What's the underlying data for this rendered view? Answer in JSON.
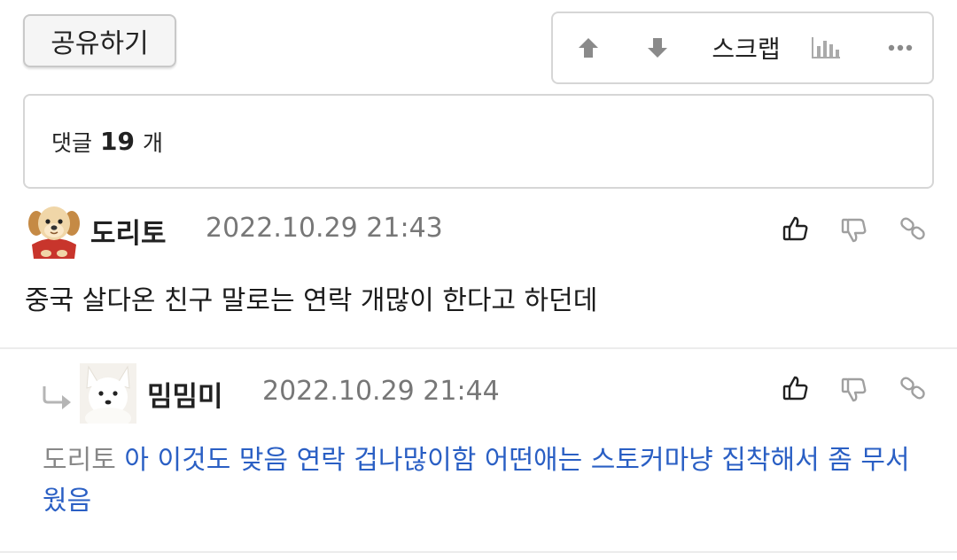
{
  "toolbar": {
    "share_label": "공유하기",
    "scrap_label": "스크랩"
  },
  "comments_header": {
    "prefix": "댓글",
    "count": "19",
    "suffix": "개"
  },
  "comments": [
    {
      "author": "도리토",
      "timestamp": "2022.10.29 21:43",
      "text": "중국 살다온 친구 말로는 연락 개많이 한다고 하던데",
      "avatar_icon": "puppy-avatar"
    }
  ],
  "reply": {
    "author": "밈밈미",
    "timestamp": "2022.10.29 21:44",
    "mention": "도리토",
    "text": "아 이것도 맞음 연락 겁나많이함 어떤애는 스토커마냥 집착해서 좀 무서웠음",
    "avatar_icon": "white-dog-avatar"
  },
  "icons": {
    "upvote": "arrow-up-icon",
    "downvote": "arrow-down-icon",
    "stats": "bar-chart-icon",
    "more": "more-dots-icon",
    "like": "thumbs-up-icon",
    "dislike": "thumbs-down-icon",
    "link": "link-icon",
    "reply": "reply-arrow-icon"
  },
  "colors": {
    "reply_text": "#2a5fc4",
    "mention": "#888888",
    "icon_gray": "#9a9a9a"
  }
}
